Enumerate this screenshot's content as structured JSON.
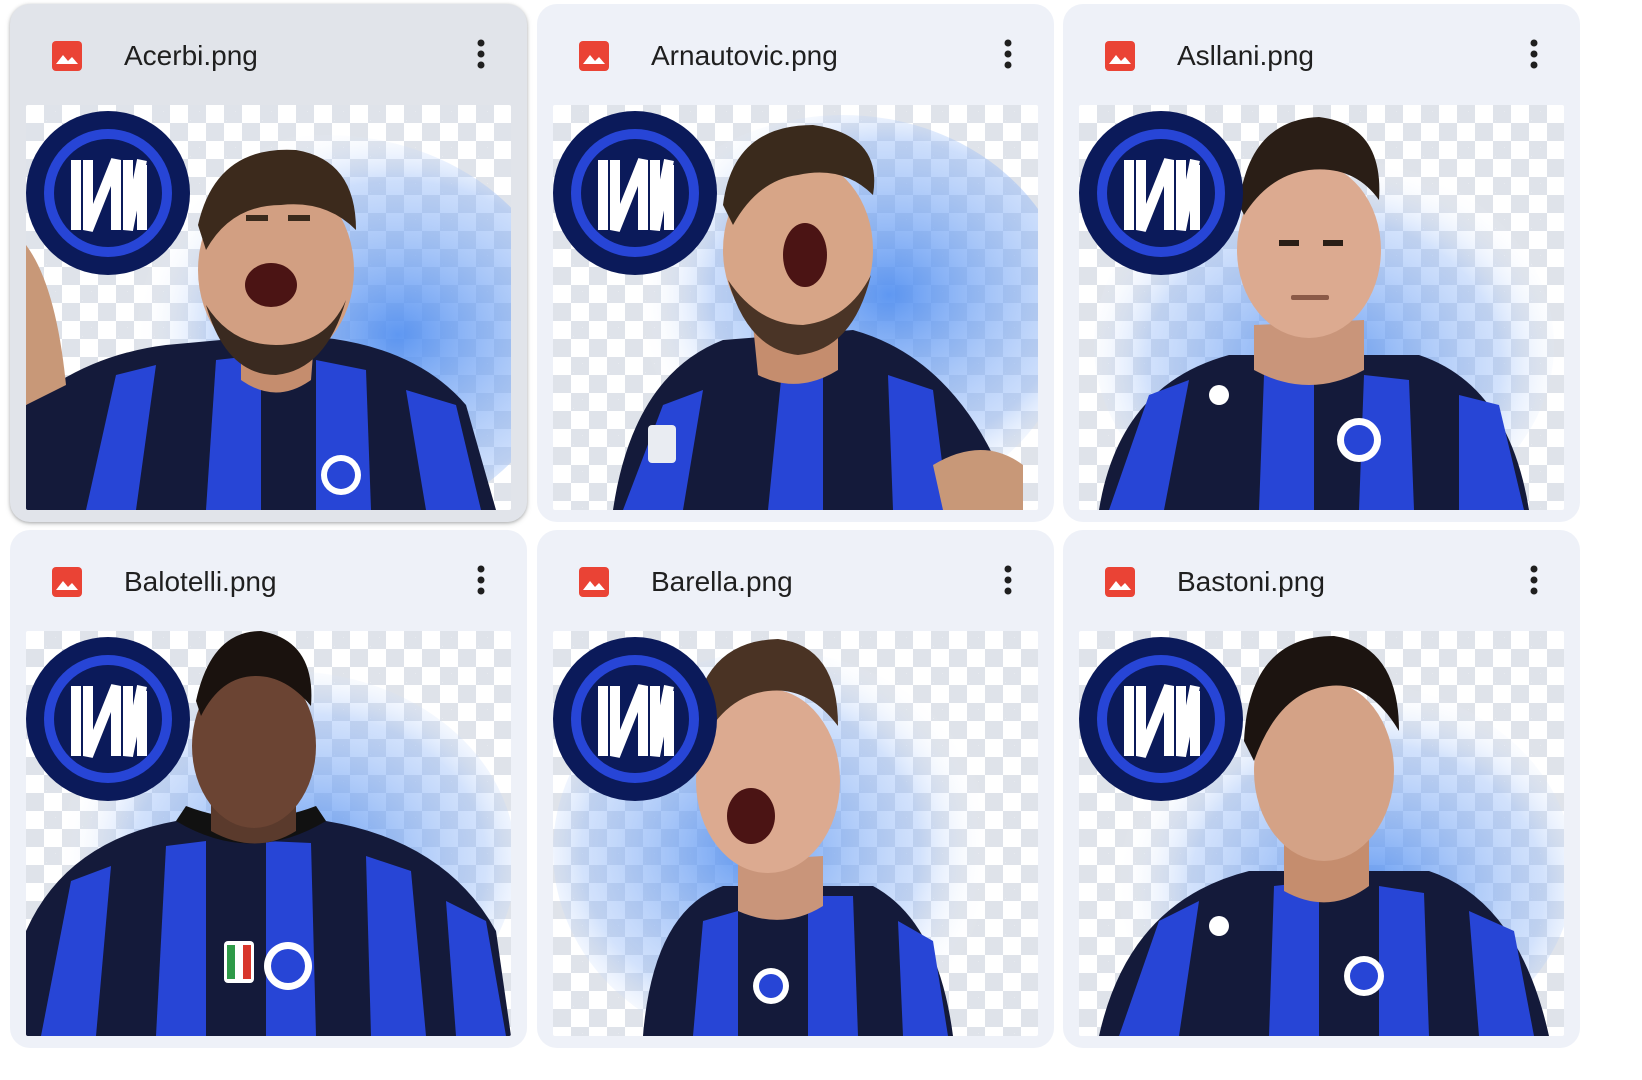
{
  "files": [
    {
      "name": "Acerbi.png",
      "type_icon": "image-file-icon",
      "selected": true
    },
    {
      "name": "Arnautovic.png",
      "type_icon": "image-file-icon",
      "selected": false
    },
    {
      "name": "Asllani.png",
      "type_icon": "image-file-icon",
      "selected": false
    },
    {
      "name": "Balotelli.png",
      "type_icon": "image-file-icon",
      "selected": false
    },
    {
      "name": "Barella.png",
      "type_icon": "image-file-icon",
      "selected": false
    },
    {
      "name": "Bastoni.png",
      "type_icon": "image-file-icon",
      "selected": false
    }
  ],
  "colors": {
    "card_bg": "#eef1f8",
    "card_selected_bg": "#e1e4ea",
    "image_icon_red": "#ea4335",
    "text": "#1f1f1f",
    "inter_blue": "#1f3ea8",
    "inter_navy": "#0b1a5a"
  }
}
